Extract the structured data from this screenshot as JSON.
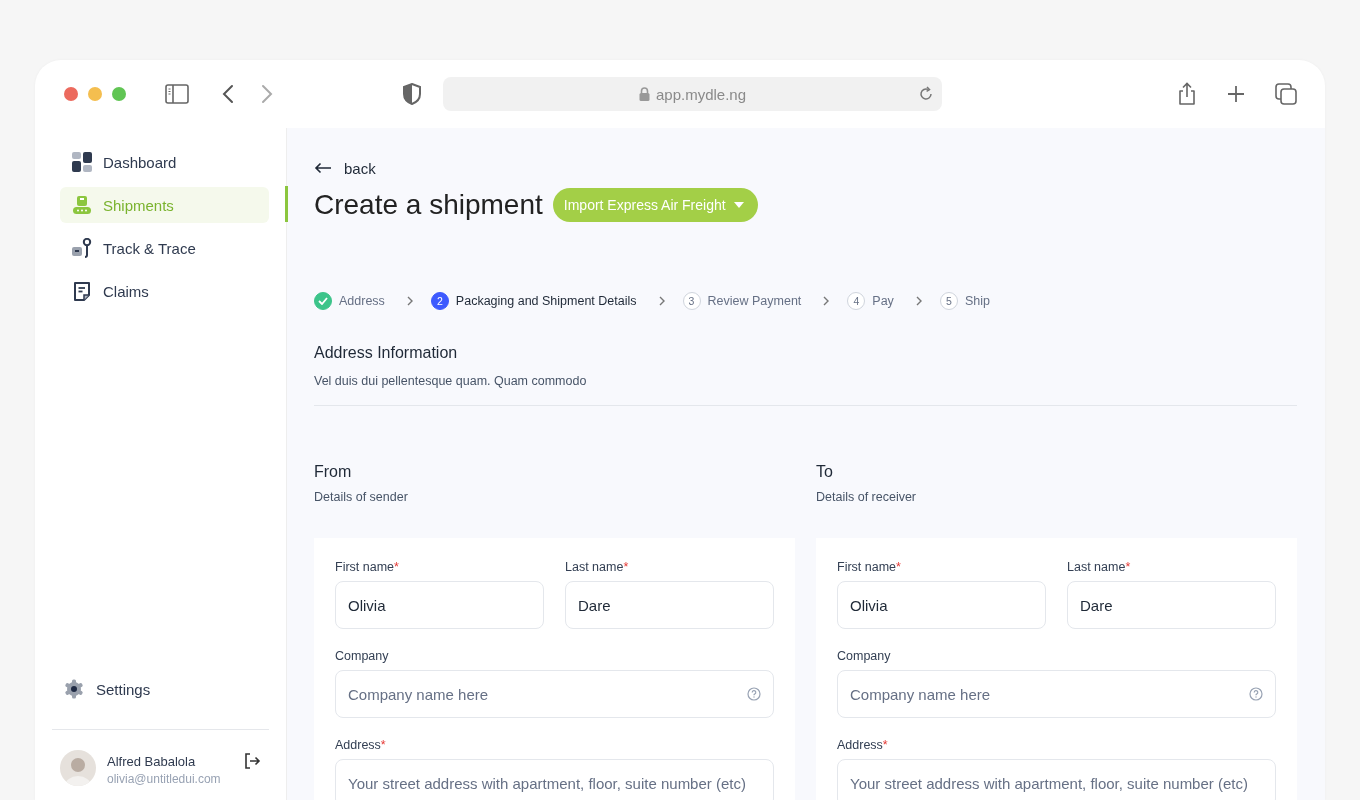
{
  "browser": {
    "url": "app.mydle.ng"
  },
  "sidebar": {
    "items": [
      {
        "label": "Dashboard",
        "selected": false
      },
      {
        "label": "Shipments",
        "selected": true
      },
      {
        "label": "Track & Trace",
        "selected": false
      },
      {
        "label": "Claims",
        "selected": false
      }
    ],
    "settings": "Settings",
    "user": {
      "name": "Alfred Babalola",
      "email": "olivia@untitledui.com"
    }
  },
  "back": "back",
  "title": "Create a shipment",
  "service": "Import Express Air Freight",
  "steps": [
    {
      "kind": "done",
      "label": "Address"
    },
    {
      "kind": "current",
      "number": "2",
      "label": "Packaging and Shipment Details"
    },
    {
      "kind": "upcoming",
      "number": "3",
      "label": "Review Payment"
    },
    {
      "kind": "upcoming",
      "number": "4",
      "label": "Pay"
    },
    {
      "kind": "upcoming",
      "number": "5",
      "label": "Ship"
    }
  ],
  "section": {
    "title": "Address Information",
    "description": "Vel duis dui pellentesque quam. Quam commodo"
  },
  "parties": [
    {
      "title": "From",
      "subtitle": "Details of sender",
      "fields": [
        {
          "kind": "half",
          "label": "First name",
          "required_mark": "*",
          "value": "Olivia"
        },
        {
          "kind": "half",
          "label": "Last name",
          "required_mark": "*",
          "value": "Dare"
        },
        {
          "kind": "full",
          "label": "Company",
          "placeholder": "Company name here",
          "help": true
        },
        {
          "kind": "full",
          "label": "Address",
          "required_mark": "*",
          "placeholder": "Your street address with apartment, floor, suite number (etc)"
        }
      ]
    },
    {
      "title": "To",
      "subtitle": "Details of receiver",
      "fields": [
        {
          "kind": "half",
          "label": "First name",
          "required_mark": "*",
          "value": "Olivia"
        },
        {
          "kind": "half",
          "label": "Last name",
          "required_mark": "*",
          "value": "Dare"
        },
        {
          "kind": "full",
          "label": "Company",
          "placeholder": "Company name here",
          "help": true
        },
        {
          "kind": "full",
          "label": "Address",
          "required_mark": "*",
          "placeholder": "Your street address with apartment, floor, suite number (etc)"
        }
      ]
    }
  ]
}
